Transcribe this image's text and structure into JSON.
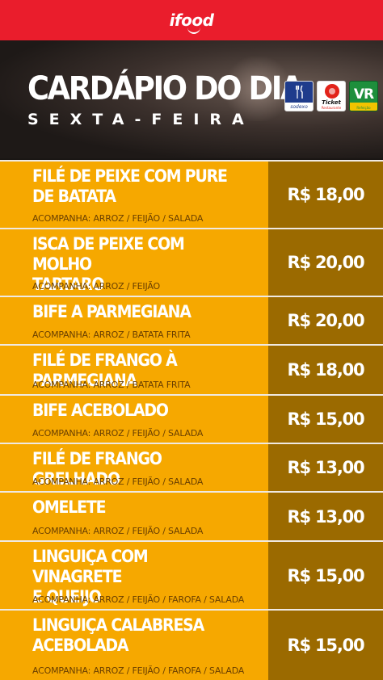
{
  "header": {
    "logo": "ifood",
    "title": "CARDÁPIO DO DIA",
    "subtitle": "SEXTA-FEIRA",
    "badges": [
      {
        "name": "sodexo",
        "label": "sodexo"
      },
      {
        "name": "ticket",
        "label": "Ticket",
        "sub": "Restaurante"
      },
      {
        "name": "vr",
        "label": "VR",
        "sub": "Refeição"
      }
    ]
  },
  "colors": {
    "top_bar": "#ea1d2c",
    "item_background": "#f6a800",
    "price_background": "#9b6a00",
    "text_white": "#ffffff"
  },
  "menu": [
    {
      "name": "FILÉ DE PEIXE COM PURE\nDE BATATA",
      "sides": "ACOMPANHA: ARROZ / FEIJÃO / SALADA",
      "price": "R$ 18,00"
    },
    {
      "name": "ISCA DE PEIXE COM MOLHO\nTARTARO",
      "sides": "ACOMPANHA: ARROZ / FEIJÃO",
      "price": "R$ 20,00"
    },
    {
      "name": "BIFE A PARMEGIANA",
      "sides": "ACOMPANHA: ARROZ / BATATA FRITA",
      "price": "R$ 20,00"
    },
    {
      "name": "FILÉ DE FRANGO À PARMEGIANA",
      "sides": "ACOMPANHA: ARROZ / BATATA FRITA",
      "price": "R$ 18,00"
    },
    {
      "name": "BIFE ACEBOLADO",
      "sides": "ACOMPANHA: ARROZ / FEIJÃO / SALADA",
      "price": "R$ 15,00"
    },
    {
      "name": "FILÉ DE FRANGO GRELHADO",
      "sides": "ACOMPANHA: ARROZ / FEIJÃO / SALADA",
      "price": "R$ 13,00"
    },
    {
      "name": "OMELETE",
      "sides": "ACOMPANHA: ARROZ / FEIJÃO / SALADA",
      "price": "R$ 13,00"
    },
    {
      "name": "LINGUIÇA COM VINAGRETE\nE QUEIJO",
      "sides": "ACOMPANHA: ARROZ / FEIJÃO / FAROFA / SALADA",
      "price": "R$ 15,00"
    },
    {
      "name": "LINGUIÇA CALABRESA\nACEBOLADA",
      "sides": "ACOMPANHA: ARROZ / FEIJÃO / FAROFA / SALADA",
      "price": "R$ 15,00"
    }
  ]
}
